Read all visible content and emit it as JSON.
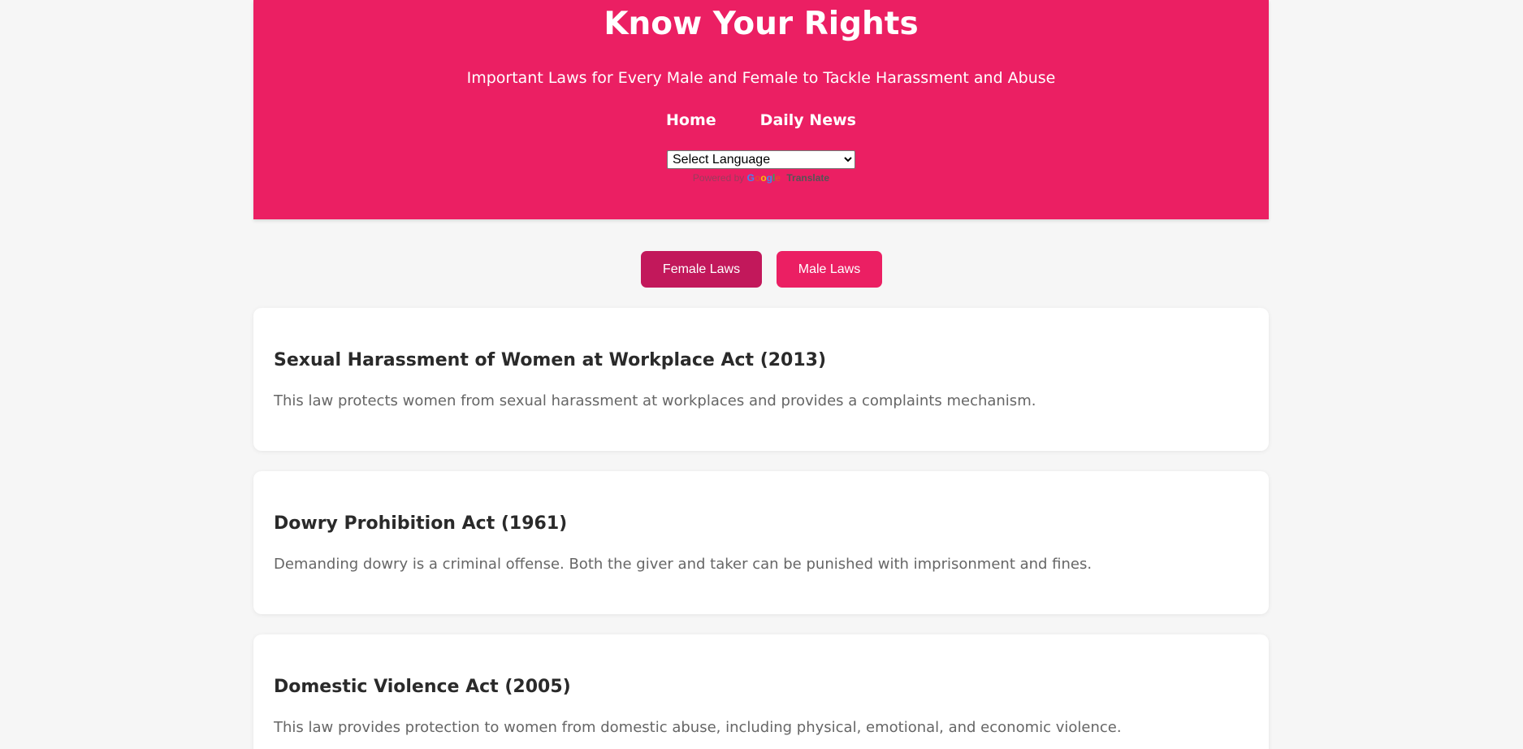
{
  "header": {
    "title": "Know Your Rights",
    "subtitle": "Important Laws for Every Male and Female to Tackle Harassment and Abuse",
    "nav": [
      {
        "label": "Home"
      },
      {
        "label": "Daily News"
      }
    ],
    "language_select": {
      "selected": "Select Language"
    },
    "powered_by": {
      "prefix": "Powered by",
      "brand_letters": [
        "G",
        "o",
        "o",
        "g",
        "l",
        "e"
      ],
      "link": "Translate"
    }
  },
  "tabs": [
    {
      "label": "Female Laws",
      "active": true
    },
    {
      "label": "Male Laws",
      "active": false
    }
  ],
  "laws": [
    {
      "title": "Sexual Harassment of Women at Workplace Act (2013)",
      "description": "This law protects women from sexual harassment at workplaces and provides a complaints mechanism."
    },
    {
      "title": "Dowry Prohibition Act (1961)",
      "description": "Demanding dowry is a criminal offense. Both the giver and taker can be punished with imprisonment and fines."
    },
    {
      "title": "Domestic Violence Act (2005)",
      "description": "This law provides protection to women from domestic abuse, including physical, emotional, and economic violence."
    }
  ],
  "colors": {
    "primary": "#eb1f63",
    "primary_active": "#c2185b",
    "background": "#f6f6f6",
    "card": "#ffffff"
  }
}
